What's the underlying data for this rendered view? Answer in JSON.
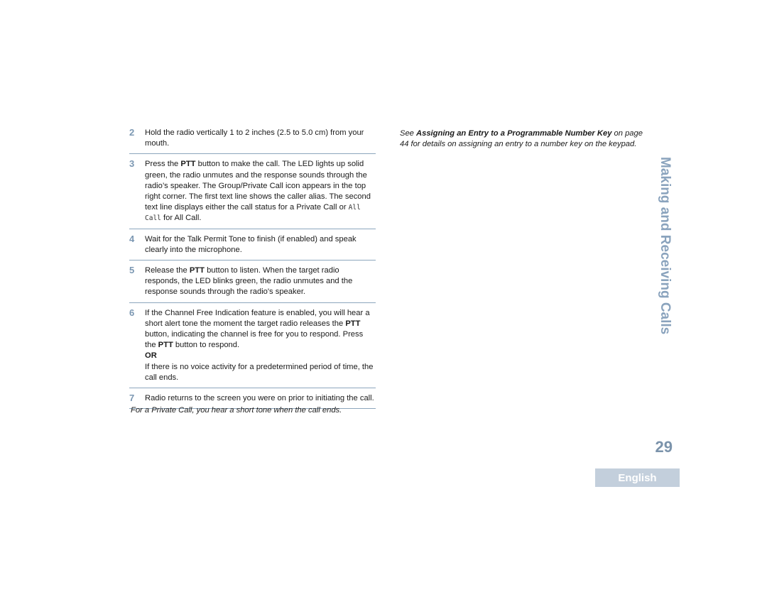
{
  "steps": [
    {
      "number": "2",
      "text": "Hold the radio vertically 1 to 2 inches (2.5 to 5.0 cm) from your mouth."
    },
    {
      "number": "3",
      "pre": "Press the ",
      "bold": "PTT",
      "text": " button to make the call. The LED lights up solid green, the radio unmutes and the response sounds through the radio’s speaker. The Group/Private Call icon appears in the top right corner. The first text line shows the caller alias. The second text line displays either the call status for a Private Call or ",
      "mono": "All Call",
      "post": " for All Call."
    },
    {
      "number": "4",
      "text": "Wait for the Talk Permit Tone to finish (if enabled) and speak clearly into the microphone."
    },
    {
      "number": "5",
      "pre": "Release the ",
      "bold": "PTT",
      "text": " button to listen. When the target radio responds, the LED blinks green, the radio unmutes and the response sounds through the radio's speaker."
    },
    {
      "number": "6",
      "pre": "If the Channel Free Indication feature is enabled, you will hear a short alert tone the moment the target radio releases the ",
      "bold": "PTT",
      "mid": " button, indicating the channel is free for you to respond. Press the ",
      "bold2": "PTT",
      "post": " button to respond.",
      "or": "OR",
      "alt": "If there is no voice activity for a predetermined period of time, the call ends."
    },
    {
      "number": "7",
      "text": "Radio returns to the screen you were on prior to initiating the call."
    }
  ],
  "note": "For a Private Call, you hear a short tone when the call ends.",
  "see_also": {
    "pre": "See ",
    "link": "Assigning an Entry to a Programmable Number Key",
    "post": " on page 44 for details on assigning an entry to a number key on the keypad."
  },
  "side_title": "Making and Receiving Calls",
  "page_number": "29",
  "language_tab": "English"
}
